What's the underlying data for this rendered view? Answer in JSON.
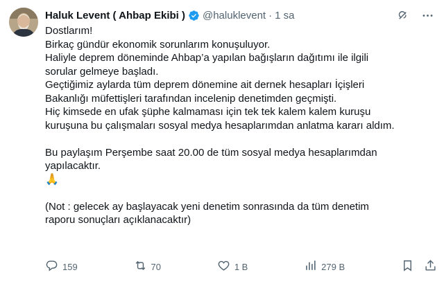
{
  "author": {
    "name": "Haluk Levent ( Ahbap Ekibi )",
    "handle": "@haluklevent",
    "separator": "·",
    "time": "1 sa"
  },
  "tweet": {
    "lines": [
      "Dostlarım!",
      "Birkaç gündür ekonomik sorunlarım konuşuluyor.",
      "Haliyle deprem döneminde Ahbap’a yapılan bağışların dağıtımı ile ilgili",
      "sorular gelmeye başladı.",
      "Geçtiğimiz aylarda tüm deprem dönemine ait dernek hesapları İçişleri",
      "Bakanlığı müfettişleri tarafından incelenip denetimden geçmişti.",
      "Hiç kimsede en ufak şüphe kalmaması için tek tek kalem kalem kuruşu",
      "kuruşuna bu çalışmaları sosyal medya hesaplarımdan anlatma kararı aldım.",
      "",
      "Bu paylaşım Perşembe saat 20.00 de tüm sosyal medya hesaplarımdan",
      "yapılacaktır.",
      "🙏",
      "",
      "(Not : gelecek ay başlayacak yeni denetim sonrasında da tüm denetim",
      "raporu sonuçları açıklanacaktır)"
    ]
  },
  "actions": {
    "replies": "159",
    "reposts": "70",
    "likes": "1 B",
    "views": "279 B"
  },
  "icons": {
    "verified": "verified-badge-icon",
    "grok": "grok-icon",
    "more": "more-icon",
    "reply": "reply-icon",
    "repost": "repost-icon",
    "like": "heart-icon",
    "views": "views-icon",
    "bookmark": "bookmark-icon",
    "share": "share-icon"
  },
  "colors": {
    "text": "#0f1419",
    "secondary": "#536471",
    "verified": "#1d9bf0"
  }
}
